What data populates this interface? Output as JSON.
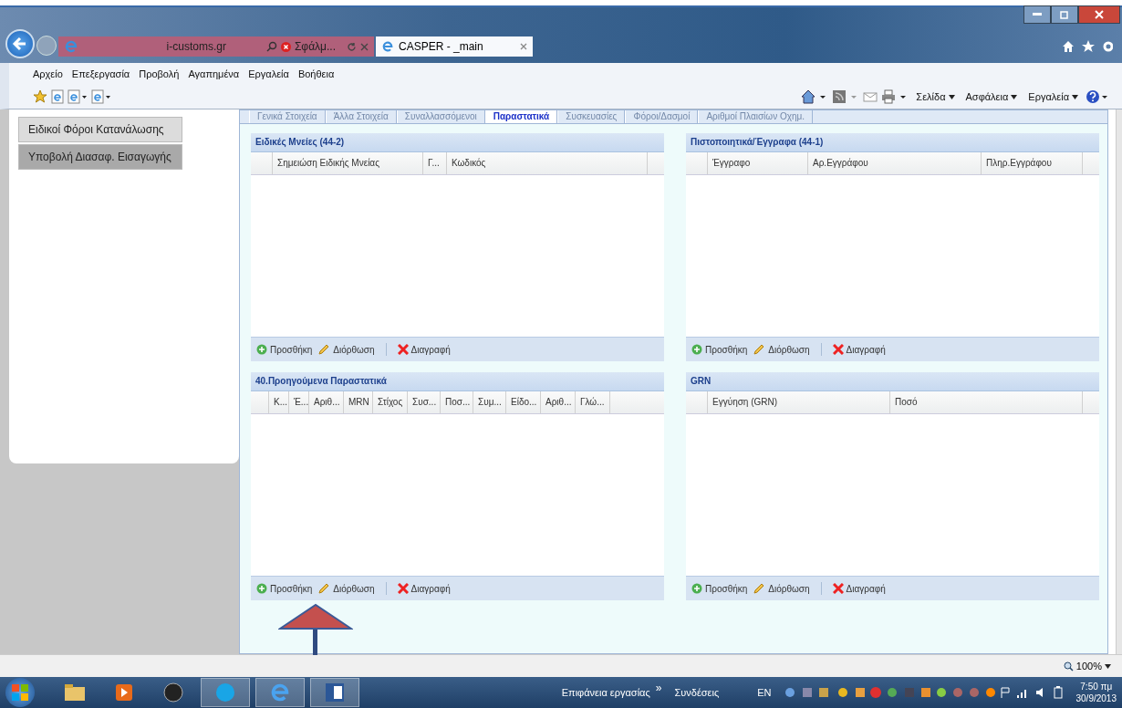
{
  "browser": {
    "address": "i-customs.gr",
    "error_tab": "Σφάλμ...",
    "tabs": [
      {
        "title": "CASPER - _main",
        "selected": true
      }
    ],
    "menu": [
      "Αρχείο",
      "Επεξεργασία",
      "Προβολή",
      "Αγαπημένα",
      "Εργαλεία",
      "Βοήθεια"
    ],
    "command_bar": [
      "Σελίδα",
      "Ασφάλεια",
      "Εργαλεία"
    ]
  },
  "sidebar": {
    "items": [
      {
        "label": "Ειδικοί Φόροι Κατανάλωσης",
        "selected": false
      },
      {
        "label": "Υποβολή Διασαφ. Εισαγωγής",
        "selected": true
      }
    ]
  },
  "tabs": [
    {
      "label": "Γενικά Στοιχεία",
      "selected": false
    },
    {
      "label": "Άλλα Στοιχεία",
      "selected": false
    },
    {
      "label": "Συναλλασσόμενοι",
      "selected": false
    },
    {
      "label": "Παραστατικά",
      "selected": true
    },
    {
      "label": "Συσκευασίες",
      "selected": false
    },
    {
      "label": "Φόροι/Δασμοί",
      "selected": false
    },
    {
      "label": "Αριθμοί Πλαισίων Οχημ.",
      "selected": false
    }
  ],
  "panels": [
    {
      "title": "Ειδικές Μνείες (44-2)",
      "columns": [
        "Σημειώση Ειδικής Μνείας",
        "Γ...",
        "Κωδικός"
      ],
      "toolbar": [
        {
          "kind": "add",
          "label": "Προσθήκη"
        },
        {
          "kind": "edit",
          "label": "Διόρθωση"
        },
        {
          "kind": "delete",
          "label": "Διαγραφή"
        }
      ]
    },
    {
      "title": "Πιστοποιητικά/Έγγραφα (44-1)",
      "columns": [
        "Έγγραφο",
        "Αρ.Εγγράφου",
        "Πληρ.Εγγράφου"
      ],
      "toolbar": [
        {
          "kind": "add",
          "label": "Προσθήκη"
        },
        {
          "kind": "edit",
          "label": "Διόρθωση"
        },
        {
          "kind": "delete",
          "label": "Διαγραφή"
        }
      ]
    },
    {
      "title": "40.Προηγούμενα Παραστατικά",
      "columns": [
        "Κ...",
        "Έ...",
        "Αριθ...",
        "MRN",
        "Στίχος",
        "Συσ...",
        "Ποσ...",
        "Συμ...",
        "Είδο...",
        "Αριθ...",
        "Γλώ..."
      ],
      "toolbar": [
        {
          "kind": "add",
          "label": "Προσθήκη"
        },
        {
          "kind": "edit",
          "label": "Διόρθωση"
        },
        {
          "kind": "delete",
          "label": "Διαγραφή"
        }
      ]
    },
    {
      "title": "GRN",
      "columns": [
        "Εγγύηση (GRN)",
        "Ποσό"
      ],
      "toolbar": [
        {
          "kind": "add",
          "label": "Προσθήκη"
        },
        {
          "kind": "edit",
          "label": "Διόρθωση"
        },
        {
          "kind": "delete",
          "label": "Διαγραφή"
        }
      ]
    }
  ],
  "status_bar": {
    "zoom": "100%"
  },
  "taskbar": {
    "desktop": "Επιφάνεια εργασίας",
    "chevron": "»",
    "connections": "Συνδέσεις",
    "language": "EN",
    "time": "7:50 πμ",
    "date": "30/9/2013"
  }
}
